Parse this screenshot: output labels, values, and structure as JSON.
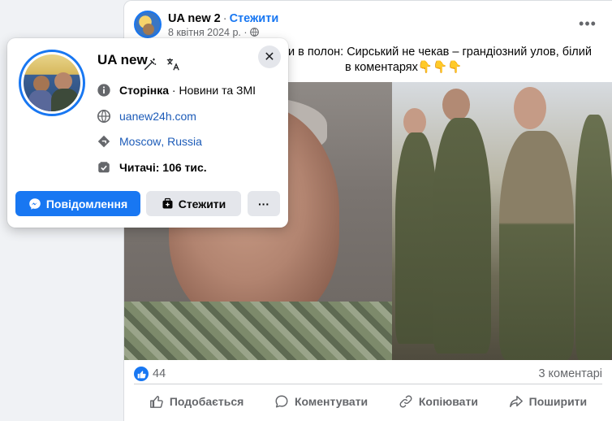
{
  "post": {
    "page_name": "UA new 2",
    "separator": "·",
    "follow_label": "Стежити",
    "date": "8 квітня 2024 р.",
    "meta_sep": "·",
    "text": "и в полон: Сирський не чекав – грандіозний улов, білий",
    "text_line2": "в коментарях👇👇👇",
    "likes": "44",
    "comments": "3 коментарі",
    "actions": {
      "like": "Подобається",
      "comment": "Коментувати",
      "copy": "Копіювати",
      "share": "Поширити"
    }
  },
  "hovercard": {
    "name": "UA new",
    "category_label": "Сторінка",
    "category_sep": " · ",
    "category_value": "Новини та ЗМІ",
    "website": "uanew24h.com",
    "location_city": "Moscow",
    "location_sep": ", ",
    "location_country": "Russia",
    "followers_label": "Читачі: 106 тис.",
    "message_button": "Повідомлення",
    "follow_button": "Стежити",
    "more_button": "···",
    "close": "✕"
  },
  "colors": {
    "accent": "#1877f2",
    "link": "#1c5bb8",
    "muted": "#65676b"
  }
}
